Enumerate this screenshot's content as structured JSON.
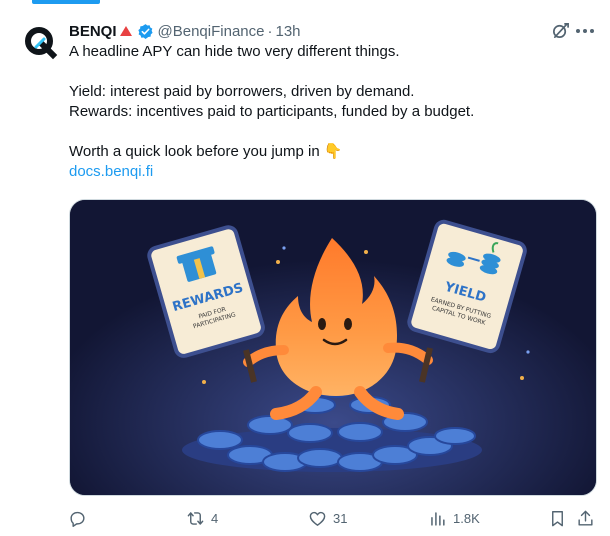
{
  "tweet": {
    "author_name": "BENQI",
    "handle": "@BenqiFinance",
    "separator": "·",
    "time": "13h",
    "text_lines": [
      "A headline APY can hide two very different things.",
      "",
      "Yield: interest paid by borrowers, driven by demand.",
      "Rewards: incentives paid to participants, funded by a budget.",
      "",
      "Worth a quick look before you jump in 👇"
    ],
    "link": "docs.benqi.fi"
  },
  "media": {
    "left_sign": {
      "title": "REWARDS",
      "line1": "PAID FOR",
      "line2": "PARTICIPATING"
    },
    "right_sign": {
      "title": "YIELD",
      "line1": "EARNED BY PUTTING",
      "line2": "CAPITAL TO WORK"
    }
  },
  "actions": {
    "reply_count": "",
    "repost_count": "4",
    "like_count": "31",
    "view_count": "1.8K"
  },
  "icons": {
    "avatar": "benqi-logo-icon",
    "verified": "verified-badge-icon",
    "grok": "grok-icon",
    "more": "more-icon",
    "reply": "reply-icon",
    "repost": "repost-icon",
    "like": "heart-icon",
    "views": "analytics-icon",
    "bookmark": "bookmark-icon",
    "share": "share-icon"
  },
  "colors": {
    "link": "#1d9bf0",
    "muted": "#536471",
    "brand_triangle": "#e84142",
    "media_bg": "#141a38"
  }
}
